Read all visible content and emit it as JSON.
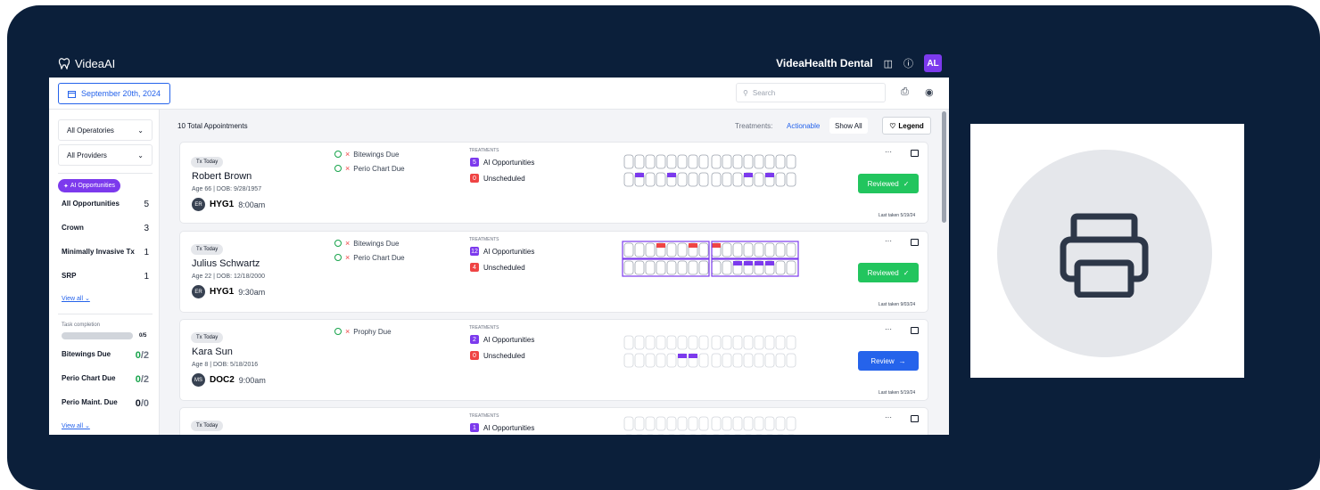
{
  "app": {
    "logo_text": "VideaAI",
    "org_name": "VideaHealth Dental",
    "user_initials": "AL"
  },
  "toolbar": {
    "date": "September 20th, 2024",
    "search_placeholder": "Search"
  },
  "sidebar": {
    "operatories": "All Operatories",
    "providers": "All Providers",
    "ai_badge": "AI Opportunities",
    "opportunities": [
      {
        "label": "All Opportunities",
        "count": "5"
      },
      {
        "label": "Crown",
        "count": "3"
      },
      {
        "label": "Minimally Invasive Tx",
        "count": "1"
      },
      {
        "label": "SRP",
        "count": "1"
      }
    ],
    "view_all": "View all",
    "task_label": "Task completion",
    "task_progress": "0/5",
    "tasks": [
      {
        "label": "Bitewings Due",
        "done": "0",
        "total": "/2"
      },
      {
        "label": "Perio Chart Due",
        "done": "0",
        "total": "/2"
      },
      {
        "label": "Perio Maint. Due",
        "done": "0",
        "total": "/0"
      }
    ],
    "view_all_2": "View all"
  },
  "main": {
    "total": "10 Total Appointments",
    "treatments_label": "Treatments:",
    "tab_actionable": "Actionable",
    "tab_show_all": "Show All",
    "legend_label": "Legend",
    "treatments_heading": "TREATMENTS",
    "more": "···",
    "ai_label": "AI Opportunities",
    "unscheduled_label": "Unscheduled"
  },
  "appointments": [
    {
      "tag": "Tx Today",
      "name": "Robert Brown",
      "meta": "Age 66 | DOB: 9/28/1957",
      "initials": "ER",
      "code": "HYG1",
      "time": "8:00am",
      "dues": [
        "Bitewings Due",
        "Perio Chart Due"
      ],
      "ai_count": "5",
      "unscheduled_count": "0",
      "action": "Reviewed",
      "action_icon": "✓",
      "last_taken": "Last taken 5/19/24"
    },
    {
      "tag": "Tx Today",
      "name": "Julius Schwartz",
      "meta": "Age 22 | DOB: 12/18/2000",
      "initials": "ER",
      "code": "HYG1",
      "time": "9:30am",
      "dues": [
        "Bitewings Due",
        "Perio Chart Due"
      ],
      "ai_count": "12",
      "unscheduled_count": "4",
      "action": "Reviewed",
      "action_icon": "✓",
      "last_taken": "Last taken 9/03/24"
    },
    {
      "tag": "Tx Today",
      "name": "Kara Sun",
      "meta": "Age 8 | DOB: 5/18/2016",
      "initials": "MS",
      "code": "DOC2",
      "time": "9:00am",
      "dues": [
        "Prophy Due"
      ],
      "ai_count": "2",
      "unscheduled_count": "0",
      "action": "Review",
      "action_icon": "→",
      "last_taken": "Last taken 5/19/24"
    },
    {
      "tag": "Tx Today",
      "ai_count": "1"
    }
  ],
  "colors": {
    "navy": "#0b1f3a",
    "brand_purple": "#7c3aed",
    "success_green": "#22c55e",
    "primary_blue": "#2563eb",
    "alert_red": "#ef4444"
  }
}
